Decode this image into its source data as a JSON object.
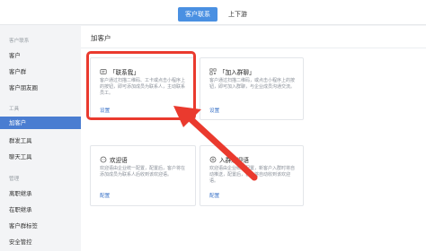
{
  "top_tabs": [
    {
      "label": "客户联系",
      "active": true
    },
    {
      "label": "上下游",
      "active": false
    }
  ],
  "sidebar": {
    "groups": [
      {
        "label": "客户联系",
        "items": [
          "客户",
          "客户群",
          "客户朋友圈"
        ]
      },
      {
        "label": "工具",
        "items": [
          "加客户",
          "群发工具",
          "聊天工具"
        ]
      },
      {
        "label": "管理",
        "items": [
          "离职继承",
          "在职继承",
          "客户群标签",
          "安全管控"
        ]
      }
    ],
    "active_item": "加客户"
  },
  "page": {
    "title": "加客户"
  },
  "cards": [
    {
      "title": "「联系我」",
      "desc": "客户通过扫描二维码、工卡或点击小程序上的按钮，即可添加成员为联系人，主动联系员工。",
      "link": "设置",
      "icon": "contact-me-icon"
    },
    {
      "title": "「加入群聊」",
      "desc": "客户通过扫描二维码，或点击小程序上的按钮，即可加入群聊，与企业成员沟通交流。",
      "link": "设置",
      "icon": "qr-code-icon"
    },
    {
      "title": "欢迎语",
      "desc": "欢迎语由企业统一配置，配置后，客户将在添加成员为联系人后收到该欢迎语。",
      "link": "配置",
      "icon": "chat-bubble-icon"
    },
    {
      "title": "入群欢迎语",
      "desc": "欢迎语由企业统一配置，新客户入群时将自动推送，配置后，客户将自动收到该欢迎语。",
      "link": "配置",
      "icon": "group-welcome-icon"
    }
  ],
  "colors": {
    "accent": "#4a90e2",
    "highlight": "#ea3a2e",
    "link": "#3b73c8"
  }
}
